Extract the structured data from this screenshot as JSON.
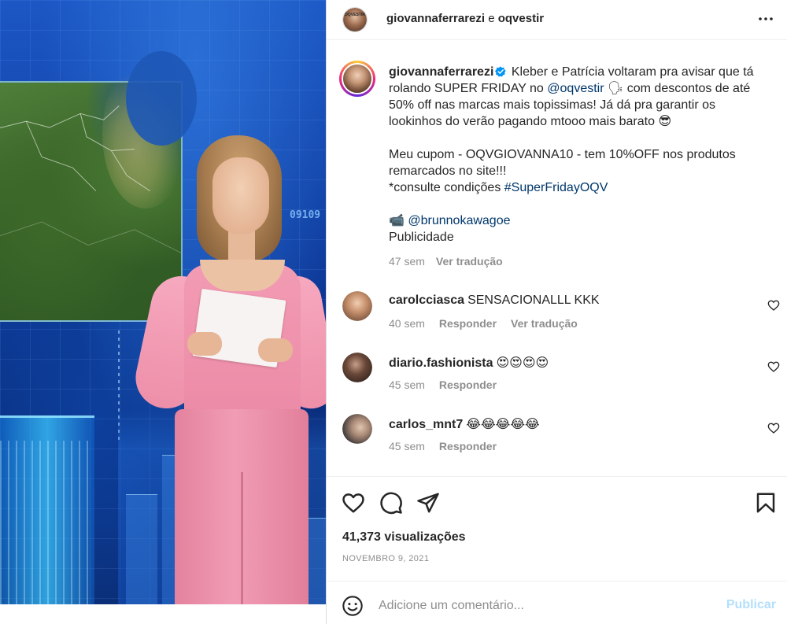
{
  "media": {
    "digits": "09109"
  },
  "header": {
    "brand": "OQVESTIR",
    "user1": "giovannaferrarezi",
    "conj": " e ",
    "user2": "oqvestir",
    "more_icon": "more-horizontal-icon"
  },
  "caption": {
    "username": "giovannaferrarezi",
    "text1": " Kleber e Patrícia voltaram pra avisar que tá rolando SUPER FRIDAY no ",
    "mention1": "@oqvestir",
    "text2": " 🗣 com descontos de até 50% off nas marcas mais topissimas! Já dá pra garantir os lookinhos do verão pagando mtooo mais barato 😎",
    "line3": "Meu cupom - OQVGIOVANNA10 - tem 10%OFF nos produtos remarcados no site!!!",
    "line4_prefix": "*consulte condições ",
    "hashtag": "#SuperFridayOQV",
    "camera_emoji": "📹",
    "mention2": "@brunnokawagoe",
    "line6": "Publicidade",
    "time": "47 sem",
    "translate": "Ver tradução"
  },
  "comments": [
    {
      "user": "carolcciasca",
      "text": "SENSACIONALLL KKK",
      "time": "40 sem",
      "reply": "Responder",
      "translate": "Ver tradução"
    },
    {
      "user": "diario.fashionista",
      "text": "😍😍😍😍",
      "time": "45 sem",
      "reply": "Responder"
    },
    {
      "user": "carlos_mnt7",
      "text": "😂😂😂😂😂",
      "time": "45 sem",
      "reply": "Responder"
    }
  ],
  "actions": {
    "like_icon": "heart-icon",
    "comment_icon": "comment-bubble-icon",
    "share_icon": "paper-plane-icon",
    "save_icon": "bookmark-icon"
  },
  "stats": {
    "views": "41,373 visualizações",
    "date": "NOVEMBRO 9, 2021"
  },
  "composer": {
    "placeholder": "Adicione um comentário...",
    "post_label": "Publicar",
    "post_color": "#b2dffc"
  },
  "colors": {
    "link": "#00376b",
    "muted": "#8e8e8e",
    "verified": "#0095f6"
  }
}
